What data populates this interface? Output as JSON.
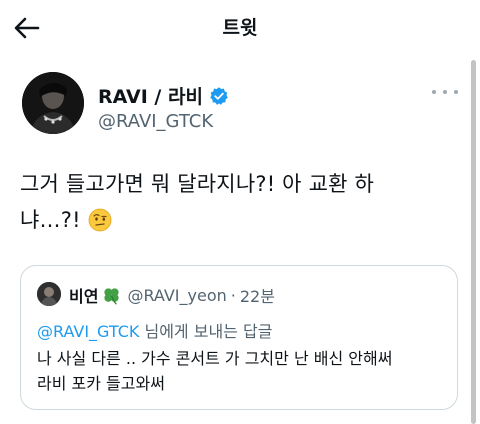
{
  "header": {
    "title": "트윗",
    "back_icon": "arrow-left-icon"
  },
  "author": {
    "name": "RAVI / 라비",
    "handle": "@RAVI_GTCK",
    "verified_icon": "verified-badge-icon",
    "verified_color": "#1d9bf0",
    "more_icon": "more-horizontal-icon"
  },
  "tweet": {
    "line1": "그거 들고가면 뭐 달라지나?! 아 교환 하",
    "line2": "냐…?!",
    "emoji": "face-with-raised-eyebrow-emoji"
  },
  "quoted": {
    "name": "비연",
    "name_emoji": "four-leaf-clover-emoji",
    "handle": "@RAVI_yeon",
    "separator": "·",
    "time": "22분",
    "reply_mention": "@RAVI_GTCK",
    "reply_suffix": " 님에게 보내는 답글",
    "text_line1": "나 사실 다른 .. 가수 콘서트 가 그치만 난 배신 안해써",
    "text_line2": "라비 포카 들고와써"
  },
  "colors": {
    "text": "#0f1419",
    "muted": "#536471",
    "accent": "#1d9bf0",
    "border": "#cfd9de"
  }
}
